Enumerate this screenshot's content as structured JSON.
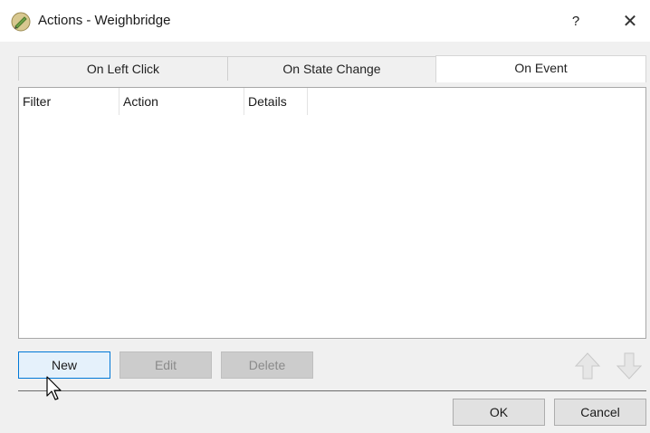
{
  "window": {
    "title": "Actions - Weighbridge",
    "help_label": "?",
    "close_label": "✕",
    "app_icon": "pencil-icon"
  },
  "tabs": [
    {
      "label": "On Left Click",
      "active": false
    },
    {
      "label": "On State Change",
      "active": false
    },
    {
      "label": "On Event",
      "active": true
    }
  ],
  "table": {
    "columns": [
      "Filter",
      "Action",
      "Details"
    ],
    "rows": []
  },
  "buttons": {
    "new": "New",
    "edit": "Edit",
    "delete": "Delete",
    "ok": "OK",
    "cancel": "Cancel"
  },
  "icons": {
    "move_up": "arrow-up-icon",
    "move_down": "arrow-down-icon"
  },
  "colors": {
    "accent": "#0078d7",
    "background": "#f0f0f0"
  }
}
